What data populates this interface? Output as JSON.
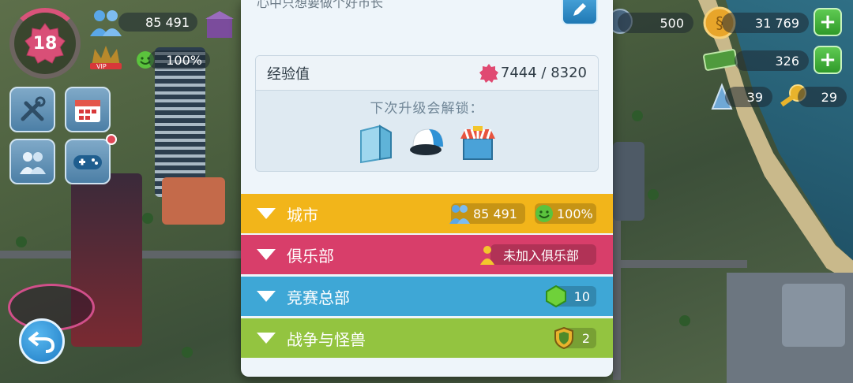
{
  "hud": {
    "level": "18",
    "population": "85 491",
    "happiness": "100%",
    "vip_label": "VIP",
    "simoleons": "31 769",
    "simcash": "326",
    "golden_keys_left": "500",
    "war_simoleons": "39",
    "keys": "29"
  },
  "panel": {
    "top_text": "心中只想要做个好市长",
    "xp": {
      "title": "经验值",
      "value": "7444 / 8320"
    },
    "unlock_text": "下次升级会解锁："
  },
  "sections": {
    "city": {
      "label": "城市",
      "population": "85 491",
      "happiness": "100%"
    },
    "club": {
      "label": "俱乐部",
      "status": "未加入俱乐部"
    },
    "contest": {
      "label": "竞赛总部",
      "value": "10"
    },
    "war": {
      "label": "战争与怪兽",
      "value": "2"
    }
  },
  "colors": {
    "city": "#f2b51a",
    "club": "#d83e6a",
    "contest": "#3ea7d6",
    "war": "#93c440",
    "panel_bg": "#eef5fa"
  },
  "icons": {
    "hud": [
      "population-icon",
      "happiness-icon",
      "vip-icon",
      "simoleon-icon",
      "simcash-icon",
      "key-icon",
      "settings-icon",
      "calendar-icon",
      "friends-icon",
      "gamepad-icon",
      "back-arrow-icon"
    ],
    "unlocks": [
      "glass-building-icon",
      "cap-icon",
      "shop-icon"
    ]
  }
}
